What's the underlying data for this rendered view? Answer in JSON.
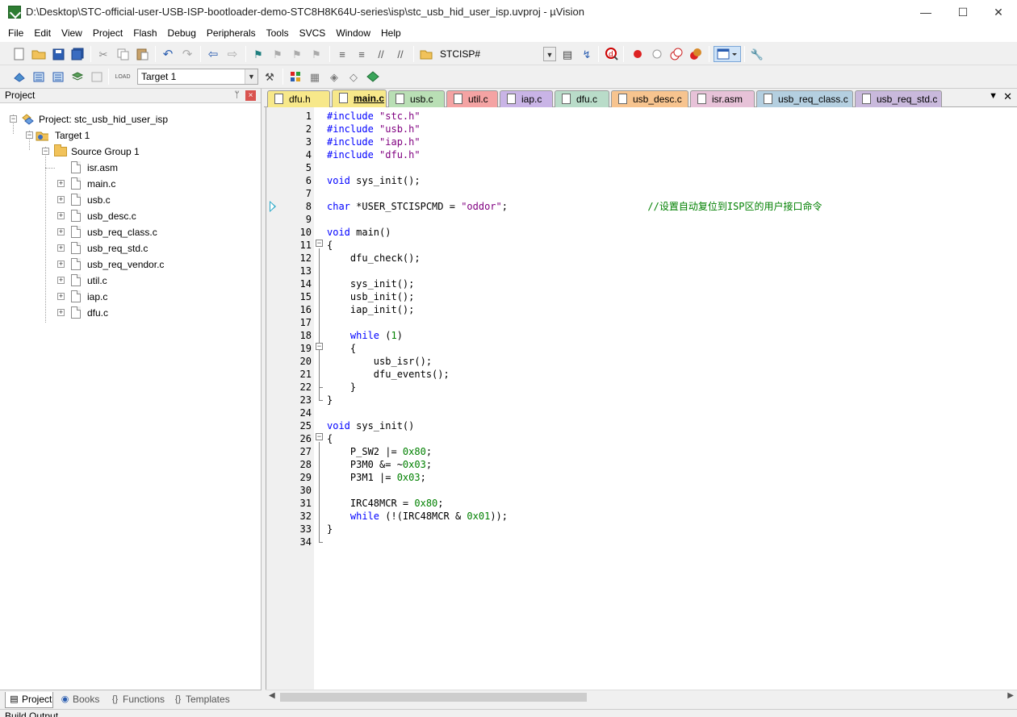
{
  "window": {
    "title": "D:\\Desktop\\STC-official-user-USB-ISP-bootloader-demo-STC8H8K64U-series\\isp\\stc_usb_hid_user_isp.uvproj - µVision",
    "minimize": "—",
    "maximize": "☐",
    "close": "✕"
  },
  "menu": [
    "File",
    "Edit",
    "View",
    "Project",
    "Flash",
    "Debug",
    "Peripherals",
    "Tools",
    "SVCS",
    "Window",
    "Help"
  ],
  "toolbar1": {
    "find_combo_value": "STCISP#",
    "icons": [
      "new-file-icon",
      "open-folder-icon",
      "save-icon",
      "save-all-icon",
      "cut-icon",
      "copy-icon",
      "paste-icon",
      "undo-icon",
      "redo-icon",
      "nav-back-icon",
      "nav-forward-icon",
      "bookmark-icon",
      "prev-bookmark-icon",
      "next-bookmark-icon",
      "clear-bookmarks-icon",
      "indent-icon",
      "unindent-icon",
      "comment-icon",
      "uncomment-icon",
      "find-in-files-icon",
      "find-icon",
      "incremental-find-icon",
      "debug-session-icon",
      "breakpoint-icon",
      "disable-breakpoint-icon",
      "disable-all-breakpoints-icon",
      "kill-all-breakpoints-icon",
      "window-layout-icon",
      "configure-icon"
    ]
  },
  "toolbar2": {
    "target_combo_value": "Target 1",
    "icons": [
      "translate-icon",
      "build-icon",
      "rebuild-icon",
      "batch-build-icon",
      "stop-build-icon",
      "download-icon",
      "target-options-icon",
      "manage-components-icon",
      "file-extensions-icon",
      "select-packs-icon",
      "pack-installer-icon",
      "rte-icon"
    ]
  },
  "project_panel": {
    "title": "Project",
    "pin": "ᛘ",
    "close": "×",
    "project_label": "Project: stc_usb_hid_user_isp",
    "target_label": "Target 1",
    "group_label": "Source Group 1",
    "files": [
      "isr.asm",
      "main.c",
      "usb.c",
      "usb_desc.c",
      "usb_req_class.c",
      "usb_req_std.c",
      "usb_req_vendor.c",
      "util.c",
      "iap.c",
      "dfu.c"
    ],
    "bottom_tabs": [
      "Project",
      "Books",
      "Functions",
      "Templates"
    ]
  },
  "editor_tabs": [
    {
      "label": "dfu.h",
      "color": "#f7e88a",
      "active": false
    },
    {
      "label": "main.c",
      "color": "#f7e88a",
      "active": true
    },
    {
      "label": "usb.c",
      "color": "#b9dfb5",
      "active": false
    },
    {
      "label": "util.c",
      "color": "#f4a3a3",
      "active": false
    },
    {
      "label": "iap.c",
      "color": "#c9b4e6",
      "active": false
    },
    {
      "label": "dfu.c",
      "color": "#b9dcc9",
      "active": false
    },
    {
      "label": "usb_desc.c",
      "color": "#f7c48f",
      "active": false
    },
    {
      "label": "isr.asm",
      "color": "#e7c2d8",
      "active": false
    },
    {
      "label": "usb_req_class.c",
      "color": "#b4cfe0",
      "active": false
    },
    {
      "label": "usb_req_std.c",
      "color": "#c9b9dc",
      "active": false
    }
  ],
  "editor_tab_menu": "▼",
  "editor_tab_close": "✕",
  "code": {
    "line_numbers": [
      "1",
      "2",
      "3",
      "4",
      "5",
      "6",
      "7",
      "8",
      "9",
      "10",
      "11",
      "12",
      "13",
      "14",
      "15",
      "16",
      "17",
      "18",
      "19",
      "20",
      "21",
      "22",
      "23",
      "24",
      "25",
      "26",
      "27",
      "28",
      "29",
      "30",
      "31",
      "32",
      "33",
      "34"
    ],
    "lines": [
      [
        [
          "pp",
          "#include "
        ],
        [
          "str",
          "\"stc.h\""
        ]
      ],
      [
        [
          "pp",
          "#include "
        ],
        [
          "str",
          "\"usb.h\""
        ]
      ],
      [
        [
          "pp",
          "#include "
        ],
        [
          "str",
          "\"iap.h\""
        ]
      ],
      [
        [
          "pp",
          "#include "
        ],
        [
          "str",
          "\"dfu.h\""
        ]
      ],
      [],
      [
        [
          "kw",
          "void"
        ],
        [
          "t",
          " sys_init();"
        ]
      ],
      [],
      [
        [
          "kw",
          "char"
        ],
        [
          "t",
          " *USER_STCISPCMD = "
        ],
        [
          "str",
          "\"oddor\""
        ],
        [
          "t",
          ";                        "
        ],
        [
          "cmt",
          "//设置自动复位到ISP区的用户接口命令"
        ]
      ],
      [],
      [
        [
          "kw",
          "void"
        ],
        [
          "t",
          " main()"
        ]
      ],
      [
        [
          "t",
          "{"
        ]
      ],
      [
        [
          "t",
          "    dfu_check();"
        ]
      ],
      [],
      [
        [
          "t",
          "    sys_init();"
        ]
      ],
      [
        [
          "t",
          "    usb_init();"
        ]
      ],
      [
        [
          "t",
          "    iap_init();"
        ]
      ],
      [],
      [
        [
          "t",
          "    "
        ],
        [
          "kw",
          "while"
        ],
        [
          "t",
          " ("
        ],
        [
          "num",
          "1"
        ],
        [
          "t",
          ")"
        ]
      ],
      [
        [
          "t",
          "    {"
        ]
      ],
      [
        [
          "t",
          "        usb_isr();"
        ]
      ],
      [
        [
          "t",
          "        dfu_events();"
        ]
      ],
      [
        [
          "t",
          "    }"
        ]
      ],
      [
        [
          "t",
          "}"
        ]
      ],
      [],
      [
        [
          "kw",
          "void"
        ],
        [
          "t",
          " sys_init()"
        ]
      ],
      [
        [
          "t",
          "{"
        ]
      ],
      [
        [
          "t",
          "    P_SW2 |= "
        ],
        [
          "num",
          "0x80"
        ],
        [
          "t",
          ";"
        ]
      ],
      [
        [
          "t",
          "    P3M0 &= ~"
        ],
        [
          "num",
          "0x03"
        ],
        [
          "t",
          ";"
        ]
      ],
      [
        [
          "t",
          "    P3M1 |= "
        ],
        [
          "num",
          "0x03"
        ],
        [
          "t",
          ";"
        ]
      ],
      [],
      [
        [
          "t",
          "    IRC48MCR = "
        ],
        [
          "num",
          "0x80"
        ],
        [
          "t",
          ";"
        ]
      ],
      [
        [
          "t",
          "    "
        ],
        [
          "kw",
          "while"
        ],
        [
          "t",
          " (!(IRC48MCR & "
        ],
        [
          "num",
          "0x01"
        ],
        [
          "t",
          "));"
        ]
      ],
      [
        [
          "t",
          "}"
        ]
      ],
      []
    ]
  },
  "status": "Build Output"
}
